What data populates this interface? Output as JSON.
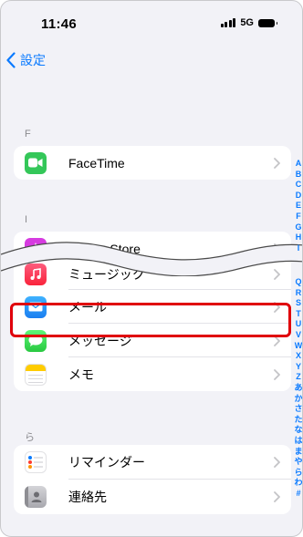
{
  "status_bar": {
    "time": "11:46",
    "network": "5G"
  },
  "nav": {
    "back_label": "設定"
  },
  "sections": {
    "f": {
      "header": "F",
      "items": [
        {
          "label": "FaceTime"
        }
      ]
    },
    "i": {
      "header": "I",
      "items": [
        {
          "label": "iTunes Store"
        }
      ]
    },
    "m": {
      "items": [
        {
          "label": "ミュージック"
        },
        {
          "label": "メール"
        },
        {
          "label": "メッセージ"
        },
        {
          "label": "メモ"
        }
      ]
    },
    "ra": {
      "header": "ら",
      "items": [
        {
          "label": "リマインダー"
        },
        {
          "label": "連絡先"
        }
      ]
    }
  },
  "index": {
    "top": [
      "A",
      "B",
      "C",
      "D",
      "E",
      "F",
      "G",
      "H",
      "I"
    ],
    "bottom": [
      "Q",
      "R",
      "S",
      "T",
      "U",
      "V",
      "W",
      "X",
      "Y",
      "Z",
      "あ",
      "か",
      "さ",
      "た",
      "な",
      "は",
      "ま",
      "や",
      "ら",
      "わ",
      "#"
    ]
  },
  "colors": {
    "accent": "#0a7aff",
    "highlight": "#e0000b",
    "facetime": "#34c759",
    "itunes": "#d63be0",
    "music": "#fa2d48",
    "mail": "#1d8ff2",
    "messages": "#30d158",
    "notes": "#ffcc00"
  }
}
